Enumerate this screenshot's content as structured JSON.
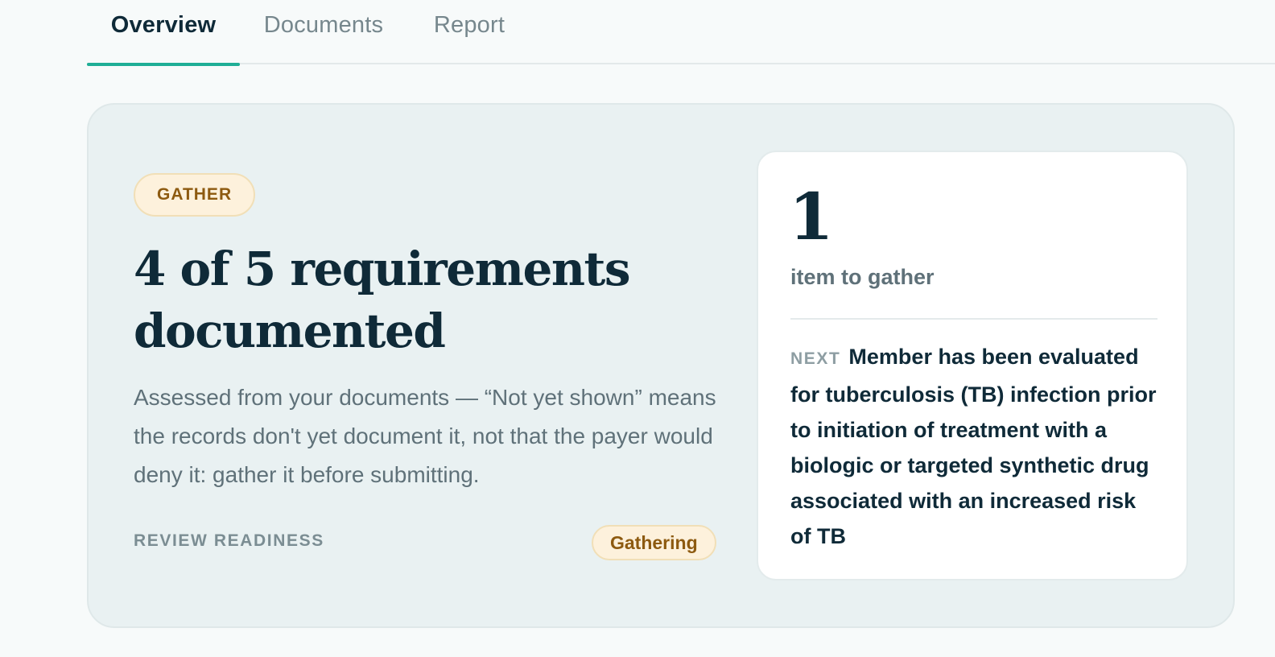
{
  "tabs": [
    {
      "label": "Overview",
      "active": true
    },
    {
      "label": "Documents",
      "active": false
    },
    {
      "label": "Report",
      "active": false
    }
  ],
  "summary": {
    "phase_badge": "GATHER",
    "headline": "4 of 5 requirements documented",
    "requirements_documented": 4,
    "requirements_total": 5,
    "description": "Assessed from your documents — “Not yet shown” means the records don't yet document it, not that the payer would deny it: gather it before submitting.",
    "readiness_label": "REVIEW READINESS",
    "readiness_status": "Gathering"
  },
  "gather_panel": {
    "count": "1",
    "caption": "item to gather",
    "next_label": "NEXT",
    "next_text": "Member has been evaluated for tuberculosis (TB) infection prior to initiation of treatment with a biologic or targeted synthetic drug associated with an increased risk of TB"
  },
  "colors": {
    "accent": "#1fae96",
    "heading": "#0f2a38",
    "muted": "#5f7179",
    "badge_bg": "#fdf1dc",
    "badge_text": "#8d5a10",
    "card_bg": "#e9f1f2",
    "page_bg": "#f7fafa"
  }
}
